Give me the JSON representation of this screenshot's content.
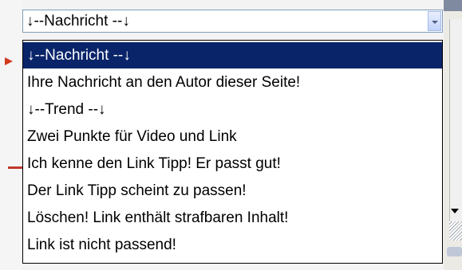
{
  "select": {
    "current_value": "↓--Nachricht --↓"
  },
  "dropdown": {
    "options": [
      {
        "label": "↓--Nachricht --↓",
        "selected": true
      },
      {
        "label": "Ihre Nachricht an den Autor dieser Seite!",
        "selected": false
      },
      {
        "label": "↓--Trend --↓",
        "selected": false
      },
      {
        "label": "Zwei Punkte für Video und Link",
        "selected": false
      },
      {
        "label": "Ich kenne den Link Tipp! Er passt gut!",
        "selected": false
      },
      {
        "label": "Der Link Tipp scheint zu passen!",
        "selected": false
      },
      {
        "label": "Löschen! Link enthält strafbaren Inhalt!",
        "selected": false
      },
      {
        "label": "Link ist nicht passend!",
        "selected": false
      }
    ]
  },
  "colors": {
    "selection_background": "#0a246a",
    "selection_text": "#ffffff",
    "marker": "#d23a1f"
  },
  "icons": {
    "dropdown_button": "chevron-down-icon",
    "pointer": "arrow-right-icon"
  }
}
